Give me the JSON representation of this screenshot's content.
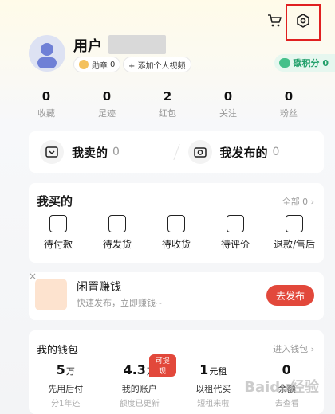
{
  "header": {
    "cart_icon": "cart-icon",
    "settings_icon": "settings-hexagon-icon"
  },
  "profile": {
    "username": "用户",
    "medal_label": "勋章",
    "medal_count": "0",
    "add_video_label": "+ 添加个人视频",
    "carbon_label": "碳积分 0"
  },
  "stats": [
    {
      "value": "0",
      "label": "收藏"
    },
    {
      "value": "0",
      "label": "足迹"
    },
    {
      "value": "2",
      "label": "红包"
    },
    {
      "value": "0",
      "label": "关注"
    },
    {
      "value": "0",
      "label": "粉丝"
    }
  ],
  "sell": {
    "sold_label": "我卖的",
    "sold_count": "0",
    "published_label": "我发布的",
    "published_count": "0"
  },
  "bought": {
    "title": "我买的",
    "all_label": "全部 0 ›",
    "items": [
      {
        "label": "待付款",
        "icon": "wallet-card-icon"
      },
      {
        "label": "待发货",
        "icon": "package-box-icon"
      },
      {
        "label": "待收货",
        "icon": "delivery-truck-icon"
      },
      {
        "label": "待评价",
        "icon": "review-note-icon"
      },
      {
        "label": "退款/售后",
        "icon": "refund-return-icon"
      }
    ]
  },
  "idle_promo": {
    "close": "×",
    "title": "闲置赚钱",
    "subtitle": "快速发布，立即赚钱~",
    "button": "去发布"
  },
  "wallet": {
    "title": "我的钱包",
    "link": "进入钱包 ›",
    "items": [
      {
        "value": "5",
        "unit": "万",
        "label": "先用后付",
        "sub": "分1年还",
        "badge": ""
      },
      {
        "value": "4.3",
        "unit": "万",
        "label": "我的账户",
        "sub": "额度已更新",
        "badge": "可提现"
      },
      {
        "value": "1",
        "unit": "元租",
        "label": "以租代买",
        "sub": "短租来啦",
        "badge": ""
      },
      {
        "value": "0",
        "unit": "",
        "label": "余额",
        "sub": "去查看",
        "badge": ""
      }
    ]
  },
  "watermark": "Baidu经验"
}
